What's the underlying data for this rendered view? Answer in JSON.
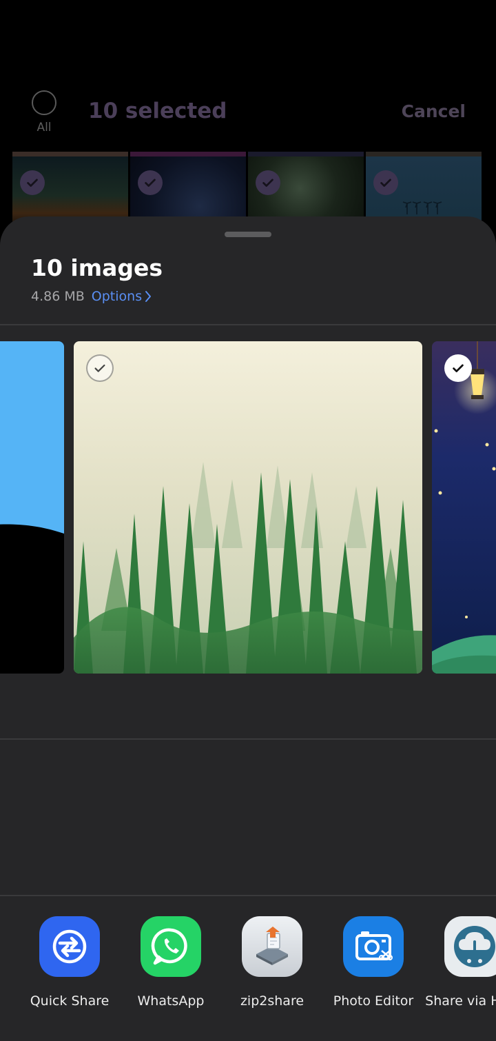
{
  "background": {
    "select_all_label": "All",
    "selected_title": "10 selected",
    "cancel_label": "Cancel"
  },
  "sheet": {
    "title": "10 images",
    "size": "4.86 MB",
    "options_label": "Options"
  },
  "previews": [
    {
      "name": "blue-sky-image",
      "checked": true
    },
    {
      "name": "misty-forest-image",
      "checked": false
    },
    {
      "name": "night-lantern-image",
      "checked": true
    }
  ],
  "apps": [
    {
      "label": "Quick Share",
      "icon": "quick-share-icon",
      "color": "#2f66f0"
    },
    {
      "label": "WhatsApp",
      "icon": "whatsapp-icon",
      "color": "#25d366"
    },
    {
      "label": "zip2share",
      "icon": "zip2share-icon",
      "color": "#dfe3e7"
    },
    {
      "label": "Photo Editor",
      "icon": "photo-editor-icon",
      "color": "#1b7fe4"
    },
    {
      "label": "Share via HTTP",
      "icon": "share-http-icon",
      "color": "#e8ecef"
    }
  ],
  "colors": {
    "accent": "#5a8ff4",
    "sheet_bg": "#262628"
  }
}
